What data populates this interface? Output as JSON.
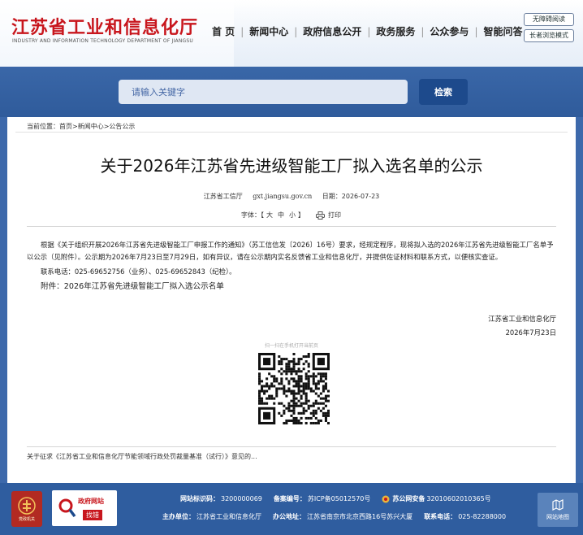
{
  "header": {
    "logo_cn": "江苏省工业和信息化厅",
    "logo_en": "INDUSTRY AND INFORMATION TECHNOLOGY DEPARTMENT OF JIANGSU",
    "nav": [
      "首 页",
      "新闻中心",
      "政府信息公开",
      "政务服务",
      "公众参与",
      "智能问答"
    ],
    "accessible_label": "无障碍阅读",
    "elder_label": "长者浏览模式"
  },
  "search": {
    "placeholder": "请输入关键字",
    "button_label": "检索"
  },
  "breadcrumb": "当前位置：首页>新闻中心>公告公示",
  "article": {
    "title": "关于2026年江苏省先进级智能工厂拟入选名单的公示",
    "source": "江苏省工信厅",
    "site": "gxt.jiangsu.gov.cn",
    "date": "日期：2026-07-23",
    "font_label": "字体：【",
    "font_large": "大",
    "font_medium": "中",
    "font_small": "小",
    "font_close": "】",
    "print_label": "打印",
    "paragraph1": "根据《关于组织开展2026年江苏省先进级智能工厂申报工作的通知》（苏工信信发〔2026〕16号）要求，经规定程序，现将拟入选的2026年江苏省先进级智能工厂名单予以公示（见附件）。公示期为2026年7月23日至7月29日，如有异议，请在公示期内实名反馈省工业和信息化厅，并提供佐证材料和联系方式，以便核实查证。",
    "contact": "联系电话：025-69652756（业务）、025-69652843（纪检）。",
    "attachment": "附件：2026年江苏省先进级智能工厂拟入选公示名单",
    "sign_org": "江苏省工业和信息化厅",
    "sign_date": "2026年7月23日",
    "qr_label": "扫一扫在手机打开当前页",
    "related": "关于征求《江苏省工业和信息化厅节能领域行政处罚裁量基准（试行）》意见的..."
  },
  "footer": {
    "badge1_text": "党政机关",
    "badge2_title": "政府网站",
    "badge2_sub": "找错",
    "row1": [
      {
        "k": "网站标识码：",
        "v": "3200000069"
      },
      {
        "k": "备案编号：",
        "v": "苏ICP备05012570号"
      },
      {
        "k": "苏公网安备",
        "v": "32010602010365号"
      }
    ],
    "row2": [
      {
        "k": "主办单位：",
        "v": "江苏省工业和信息化厅"
      },
      {
        "k": "办公地址：",
        "v": "江苏省南京市北京西路16号苏兴大厦"
      },
      {
        "k": "联系电话：",
        "v": "025-82288000"
      }
    ],
    "sitemap_label": "网站地图"
  },
  "colors": {
    "brand_red": "#c8161d",
    "band_blue": "#2f5b9b",
    "button_navy": "#1d4a8c"
  }
}
